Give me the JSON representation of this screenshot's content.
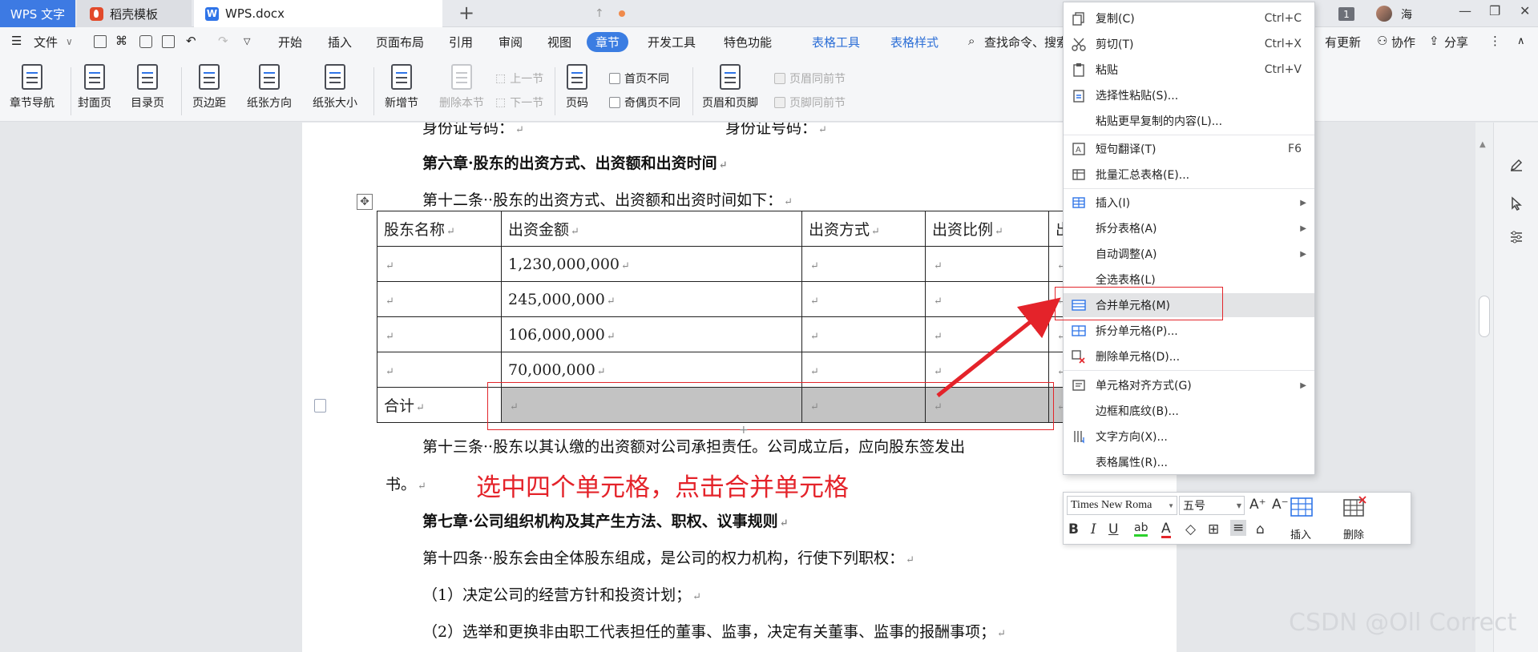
{
  "titlebar": {
    "tab_wps": "WPS 文字",
    "tab_daoke": "稻壳模板",
    "tab_doc": "WPS.docx",
    "badge": "1",
    "user": "海"
  },
  "menubar": {
    "file": "文件",
    "items": [
      "开始",
      "插入",
      "页面布局",
      "引用",
      "审阅",
      "视图",
      "章节",
      "开发工具",
      "特色功能"
    ],
    "active": "章节",
    "context_tabs": [
      "表格工具",
      "表格样式"
    ],
    "search": "查找命令、搜索",
    "right": [
      "有更新",
      "协作",
      "分享"
    ]
  },
  "ribbon": {
    "nav": "章节导航",
    "cover": "封面页",
    "toc": "目录页",
    "margin": "页边距",
    "orientation": "纸张方向",
    "size": "纸张大小",
    "new_section": "新增节",
    "delete_section": "删除本节",
    "prev_section": "上一节",
    "next_section": "下一节",
    "page_no": "页码",
    "first_diff": "首页不同",
    "odd_even_diff": "奇偶页不同",
    "header_footer": "页眉和页脚",
    "header_same": "页眉同前节",
    "footer_same": "页脚同前节"
  },
  "document": {
    "top_line_left": "身份证号码：",
    "top_line_right": "身份证号码：",
    "chapter6": "第六章·股东的出资方式、出资额和出资时间",
    "article12": "第十二条··股东的出资方式、出资额和出资时间如下：",
    "table_headers": [
      "股东名称",
      "出资金额",
      "出资方式",
      "出资比例",
      "出"
    ],
    "table_rows": [
      [
        "",
        "1,230,000,000",
        "",
        "",
        ""
      ],
      [
        "",
        "245,000,000",
        "",
        "",
        ""
      ],
      [
        "",
        "106,000,000",
        "",
        "",
        ""
      ],
      [
        "",
        "70,000,000",
        "",
        "",
        ""
      ],
      [
        "合计",
        "",
        "",
        "",
        ""
      ]
    ],
    "article13": "第十三条··股东以其认缴的出资额对公司承担责任。公司成立后，应向股东签发出",
    "article13_end": "书。",
    "chapter7": "第七章·公司组织机构及其产生方法、职权、议事规则",
    "article14": "第十四条··股东会由全体股东组成，是公司的权力机构，行使下列职权：",
    "item1": "（1）决定公司的经营方针和投资计划；",
    "item2": "（2）选举和更换非由职工代表担任的董事、监事，决定有关董事、监事的报酬事项；"
  },
  "annotation": "选中四个单元格，点击合并单元格",
  "context_menu": {
    "items": [
      {
        "label": "复制(C)",
        "shortcut": "Ctrl+C",
        "icon": "copy-icon"
      },
      {
        "label": "剪切(T)",
        "shortcut": "Ctrl+X",
        "icon": "cut-icon"
      },
      {
        "label": "粘贴",
        "shortcut": "Ctrl+V",
        "icon": "paste-icon"
      },
      {
        "label": "选择性粘贴(S)...",
        "shortcut": "",
        "icon": "paste-special-icon"
      },
      {
        "label": "粘贴更早复制的内容(L)...",
        "shortcut": "",
        "icon": ""
      },
      {
        "label": "短句翻译(T)",
        "shortcut": "F6",
        "icon": "translate-icon"
      },
      {
        "label": "批量汇总表格(E)...",
        "shortcut": "",
        "icon": "batch-table-icon"
      },
      {
        "label": "插入(I)",
        "shortcut": "",
        "icon": "insert-table-icon",
        "submenu": true
      },
      {
        "label": "拆分表格(A)",
        "shortcut": "",
        "icon": "",
        "submenu": true
      },
      {
        "label": "自动调整(A)",
        "shortcut": "",
        "icon": "",
        "submenu": true
      },
      {
        "label": "全选表格(L)",
        "shortcut": "",
        "icon": ""
      },
      {
        "label": "合并单元格(M)",
        "shortcut": "",
        "icon": "merge-cells-icon"
      },
      {
        "label": "拆分单元格(P)...",
        "shortcut": "",
        "icon": "split-cells-icon"
      },
      {
        "label": "删除单元格(D)...",
        "shortcut": "",
        "icon": "delete-cells-icon"
      },
      {
        "label": "单元格对齐方式(G)",
        "shortcut": "",
        "icon": "cell-align-icon",
        "submenu": true
      },
      {
        "label": "边框和底纹(B)...",
        "shortcut": "",
        "icon": ""
      },
      {
        "label": "文字方向(X)...",
        "shortcut": "",
        "icon": "text-direction-icon"
      },
      {
        "label": "表格属性(R)...",
        "shortcut": "",
        "icon": ""
      }
    ],
    "highlighted": "合并单元格(M)"
  },
  "mini_toolbar": {
    "font": "Times New Roma",
    "size": "五号",
    "insert": "插入",
    "delete": "删除"
  },
  "watermark": "CSDN @Oll Correct",
  "colors": {
    "accent": "#3b7de2",
    "annotation_red": "#e4232a",
    "selected_cell": "#c3c3c3"
  }
}
